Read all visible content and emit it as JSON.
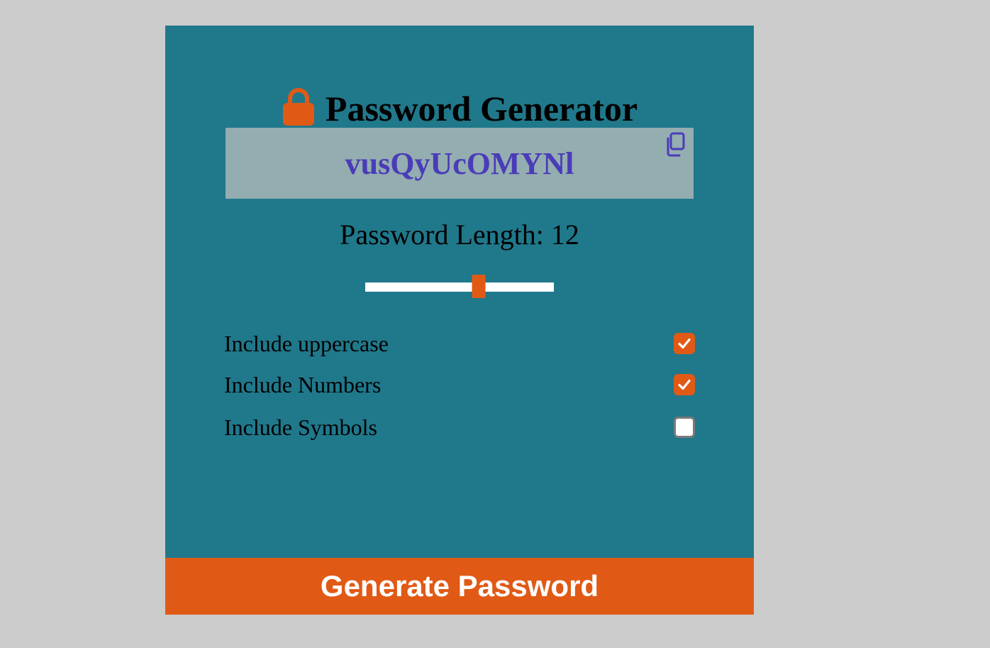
{
  "header": {
    "title": "Password Generator",
    "icon": "lock-icon"
  },
  "password": {
    "value": "vusQyUcOMYNl",
    "copy_icon": "copy-icon"
  },
  "length": {
    "label": "Password Length: 12",
    "value": 12,
    "slider_fraction": 0.6
  },
  "options": [
    {
      "label": "Include uppercase",
      "checked": true
    },
    {
      "label": "Include Numbers",
      "checked": true
    },
    {
      "label": "Include Symbols",
      "checked": false
    }
  ],
  "actions": {
    "generate_label": "Generate Password"
  },
  "colors": {
    "page_background": "#cccccc",
    "card_background": "#20788b",
    "password_box": "#94adb0",
    "password_text": "#4a3cb8",
    "accent": "#e05a16",
    "button_text": "#ffffff"
  }
}
